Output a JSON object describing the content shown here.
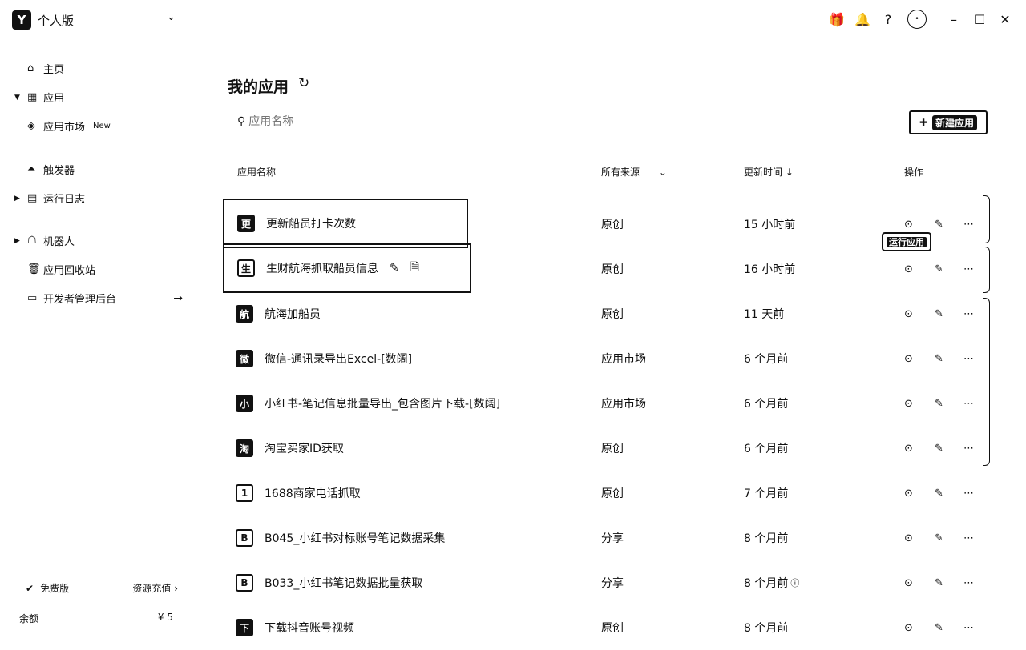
{
  "header": {
    "logo_text": "Y",
    "edition": "个人版"
  },
  "window_icons": [
    "gift-icon",
    "bell-icon",
    "help-icon",
    "avatar",
    "minimize-icon",
    "maximize-icon",
    "close-icon"
  ],
  "sidebar": {
    "items": [
      {
        "label": "主页",
        "icon": "home-icon"
      },
      {
        "label": "应用",
        "icon": "apps-icon"
      },
      {
        "label": "应用市场",
        "icon": "market-icon",
        "badge": "New"
      },
      {
        "label": "触发器",
        "icon": "trigger-icon"
      },
      {
        "label": "运行日志",
        "icon": "log-icon"
      },
      {
        "label": "机器人",
        "icon": "robot-icon"
      },
      {
        "label": "应用回收站",
        "icon": "trash-icon"
      },
      {
        "label": "开发者管理后台",
        "icon": "dev-icon"
      }
    ],
    "plan": "免费版",
    "recharge": "资源充值 ›",
    "balance_label": "余额",
    "balance_value": "¥ 5"
  },
  "main": {
    "title": "我的应用",
    "search_placeholder": "应用名称",
    "new_app": "新建应用",
    "columns": {
      "name": "应用名称",
      "source": "所有来源",
      "updated": "更新时间 ↓",
      "actions": "操作"
    },
    "tooltip": "运行应用",
    "rows": [
      {
        "icon": "更",
        "name": "更新船员打卡次数",
        "source": "原创",
        "time": "15 小时前"
      },
      {
        "icon": "生",
        "name": "生财航海抓取船员信息",
        "source": "原创",
        "time": "16 小时前"
      },
      {
        "icon": "航",
        "name": "航海加船员",
        "source": "原创",
        "time": "11 天前"
      },
      {
        "icon": "微",
        "name": "微信-通讯录导出Excel-[数阔]",
        "source": "应用市场",
        "time": "6 个月前"
      },
      {
        "icon": "小",
        "name": "小红书-笔记信息批量导出_包含图片下载-[数阔]",
        "source": "应用市场",
        "time": "6 个月前"
      },
      {
        "icon": "淘",
        "name": "淘宝买家ID获取",
        "source": "原创",
        "time": "6 个月前"
      },
      {
        "icon": "1",
        "name": "1688商家电话抓取",
        "source": "原创",
        "time": "7 个月前"
      },
      {
        "icon": "B",
        "name": "B045_小红书对标账号笔记数据采集",
        "source": "分享",
        "time": "8 个月前"
      },
      {
        "icon": "B",
        "name": "B033_小红书笔记数据批量获取",
        "source": "分享",
        "time": "8 个月前"
      },
      {
        "icon": "下",
        "name": "下载抖音账号视频",
        "source": "原创",
        "time": "8 个月前"
      }
    ]
  }
}
